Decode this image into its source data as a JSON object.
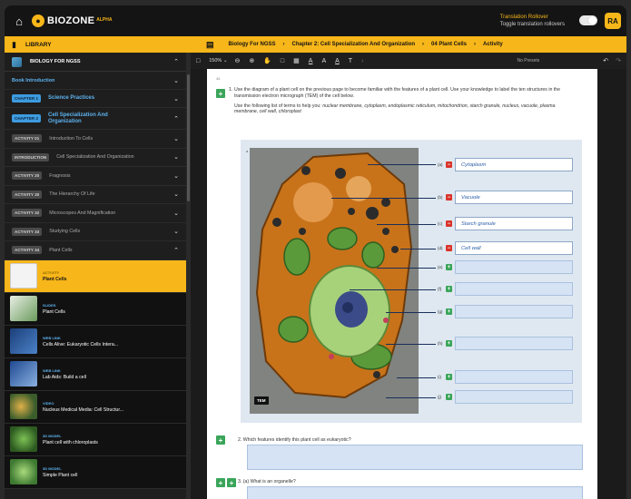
{
  "topbar": {
    "brand": "BIOZONE",
    "brand_sup": "ALPHA",
    "translation_title": "Translation Rollover",
    "translation_sub": "Toggle translation rollovers",
    "avatar": "RA"
  },
  "yellowbar": {
    "library": "LIBRARY",
    "crumbs": [
      "Biology For NGSS",
      "Chapter 2: Cell Specialization And Organization",
      "04 Plant Cells",
      "Activity"
    ]
  },
  "sidebar": {
    "header": "BIOLOGY FOR NGSS",
    "book_intro": "Book Introduction",
    "chapters": [
      {
        "pill": "CHAPTER 1",
        "label": "Science Practices"
      },
      {
        "pill": "CHAPTER 2",
        "label": "Cell Specialization And Organization"
      }
    ],
    "activities": [
      {
        "pill": "ACTIVITY 01",
        "label": "Introduction To Cells"
      },
      {
        "pill": "INTRODUCTION",
        "label": "Cell Specialization And Organization"
      },
      {
        "pill": "ACTIVITY 20",
        "label": "Fragnosis"
      },
      {
        "pill": "ACTIVITY 30",
        "label": "The Hierarchy Of Life"
      },
      {
        "pill": "ACTIVITY 32",
        "label": "Microscopes And Magnification"
      },
      {
        "pill": "ACTIVITY 33",
        "label": "Studying Cells"
      },
      {
        "pill": "ACTIVITY 34",
        "label": "Plant Cells"
      }
    ],
    "resources": [
      {
        "kind": "ACTIVITY",
        "name": "Plant Cells"
      },
      {
        "kind": "SLIDES",
        "name": "Plant Cells"
      },
      {
        "kind": "WEB LINK",
        "name": "Cells Alive: Eukaryotic Cells Intera..."
      },
      {
        "kind": "WEB LINK",
        "name": "Lab Aids: Build a cell"
      },
      {
        "kind": "VIDEO",
        "name": "Nucleus Medical Media: Cell Structur..."
      },
      {
        "kind": "3D MODEL",
        "name": "Plant cell with chloroplasts"
      },
      {
        "kind": "3D MODEL",
        "name": "Simple Plant cell"
      }
    ]
  },
  "toolbar": {
    "zoom": "150%",
    "presets": "No Presets"
  },
  "document": {
    "page_num": "46",
    "q1_num": "1.",
    "q1_text": "Use the diagram of a plant cell on the previous page to become familiar with the features of a plant cell. Use your knowledge to label the ten structures in the transmission electron micrograph (TEM) of the cell below.",
    "q1_help_prefix": "Use the following list of terms to help you:",
    "q1_terms": "nuclear membrane, cytoplasm, endoplasmic reticulum, mitochondrion, starch granule, nucleus, vacuole, plasma membrane, cell wall, chloroplast",
    "fig_num": "a",
    "tem_badge": "TEM",
    "labels": [
      {
        "letter": "(a)",
        "text": "Cytoplasm"
      },
      {
        "letter": "(b)",
        "text": "Vacuole"
      },
      {
        "letter": "(c)",
        "text": "Starch granule"
      },
      {
        "letter": "(d)",
        "text": "Cell wall"
      },
      {
        "letter": "(e)",
        "text": ""
      },
      {
        "letter": "(f)",
        "text": ""
      },
      {
        "letter": "(g)",
        "text": ""
      },
      {
        "letter": "(h)",
        "text": ""
      },
      {
        "letter": "(i)",
        "text": ""
      },
      {
        "letter": "(j)",
        "text": ""
      }
    ],
    "q2_num": "2.",
    "q2_text": "Which features identify this plant cell as eukaryotic?",
    "q3_num": "3.",
    "q3_text": "(a) What is an organelle?"
  }
}
